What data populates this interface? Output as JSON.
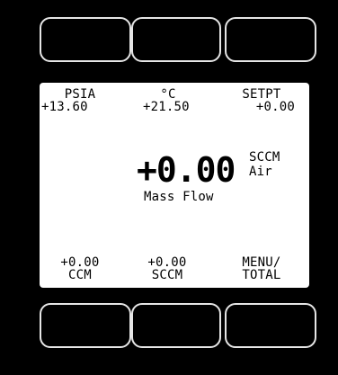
{
  "top_keys": [
    "",
    "",
    ""
  ],
  "bottom_keys": [
    "",
    "",
    ""
  ],
  "display": {
    "pressure": {
      "label": "PSIA",
      "value": "+13.60"
    },
    "temperature": {
      "label": "°C",
      "value": "+21.50"
    },
    "setpoint": {
      "label": "SETPT",
      "value": "+0.00"
    },
    "main": {
      "value": "+0.00",
      "unit": "SCCM",
      "gas": "Air",
      "label": "Mass Flow"
    },
    "volumetric": {
      "value": "+0.00",
      "label": "CCM"
    },
    "standard": {
      "value": "+0.00",
      "label": "SCCM"
    },
    "menu": {
      "line1": "MENU/",
      "line2": "TOTAL"
    }
  },
  "colors": {
    "bezel": "#000000",
    "screen": "#ffffff",
    "text": "#000000",
    "key_border": "#e6e6e6"
  }
}
